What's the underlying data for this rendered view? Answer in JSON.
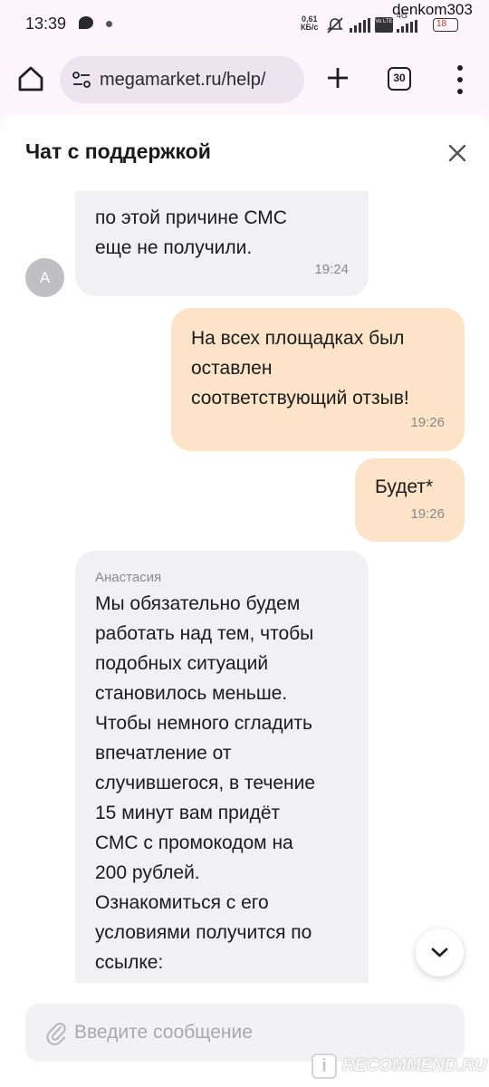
{
  "status_bar": {
    "time": "13:39",
    "net_speed_value": "0,61",
    "net_speed_unit": "КБ/с",
    "volte_label": "Vo LTE",
    "network_label": "4G",
    "battery": "18",
    "username": "denkom303"
  },
  "browser": {
    "url": "megamarket.ru/help/",
    "tab_count": "30"
  },
  "chat": {
    "title": "Чат с поддержкой",
    "messages": [
      {
        "direction": "incoming",
        "lines": [
          "по этой причине СМС",
          "еще не получили."
        ],
        "time": "19:24",
        "avatar": "А"
      },
      {
        "direction": "outgoing",
        "lines": [
          "На всех площадках был",
          "оставлен",
          "соответствующий отзыв!"
        ],
        "time": "19:26"
      },
      {
        "direction": "outgoing",
        "lines": [
          "Будет*"
        ],
        "time": "19:26"
      },
      {
        "direction": "incoming",
        "sender": "Анастасия",
        "lines": [
          "Мы обязательно будем",
          "работать над тем, чтобы",
          "подобных ситуаций",
          "становилось меньше.",
          "Чтобы немного сгладить",
          "впечатление от",
          "случившегося, в течение",
          "15 минут вам придёт",
          "СМС с промокодом на",
          "200 рублей.",
          "Ознакомиться с его",
          "условиями получится по",
          "ссылке:"
        ]
      }
    ],
    "input_placeholder": "Введите сообщение"
  },
  "watermark": {
    "badge": "i",
    "text": "RECOMMEND.RU"
  },
  "colors": {
    "incoming_bubble": "#f1f1f3",
    "outgoing_bubble": "#fde4c9",
    "browser_bg": "#fdf7fb"
  },
  "icons": [
    "home-icon",
    "site-info-icon",
    "plus-icon",
    "tabs-icon",
    "more-vertical-icon",
    "close-icon",
    "chevron-down-icon",
    "paperclip-icon"
  ]
}
